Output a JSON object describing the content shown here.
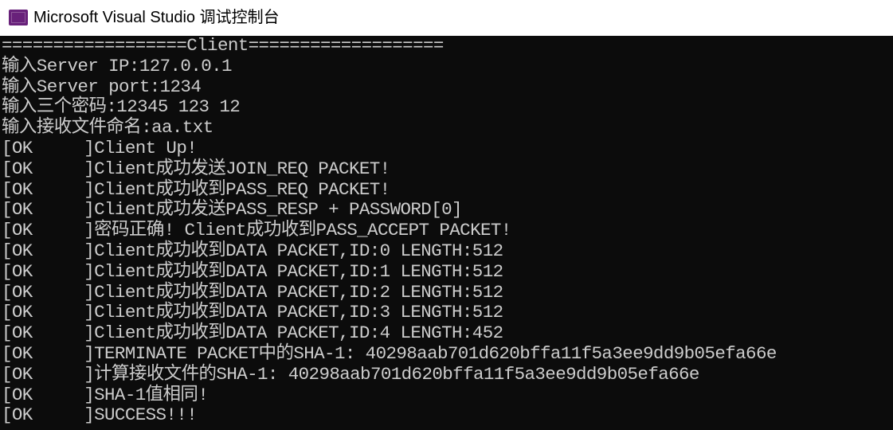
{
  "window": {
    "title": "Microsoft Visual Studio 调试控制台",
    "icon": "visual-studio-icon",
    "colors": {
      "console_background": "#0c0c0c",
      "console_text": "#cccccc",
      "titlebar_background": "#ffffff",
      "icon_accent": "#68217a"
    }
  },
  "console": {
    "lines": [
      "==================Client===================",
      "输入Server IP:127.0.0.1",
      "输入Server port:1234",
      "输入三个密码:12345 123 12",
      "输入接收文件命名:aa.txt",
      "[OK     ]Client Up!",
      "[OK     ]Client成功发送JOIN_REQ PACKET!",
      "[OK     ]Client成功收到PASS_REQ PACKET!",
      "[OK     ]Client成功发送PASS_RESP + PASSWORD[0]",
      "[OK     ]密码正确! Client成功收到PASS_ACCEPT PACKET!",
      "[OK     ]Client成功收到DATA PACKET,ID:0 LENGTH:512",
      "[OK     ]Client成功收到DATA PACKET,ID:1 LENGTH:512",
      "[OK     ]Client成功收到DATA PACKET,ID:2 LENGTH:512",
      "[OK     ]Client成功收到DATA PACKET,ID:3 LENGTH:512",
      "[OK     ]Client成功收到DATA PACKET,ID:4 LENGTH:452",
      "[OK     ]TERMINATE PACKET中的SHA-1: 40298aab701d620bffa11f5a3ee9dd9b05efa66e",
      "[OK     ]计算接收文件的SHA-1: 40298aab701d620bffa11f5a3ee9dd9b05efa66e",
      "[OK     ]SHA-1值相同!",
      "[OK     ]SUCCESS!!!"
    ]
  }
}
